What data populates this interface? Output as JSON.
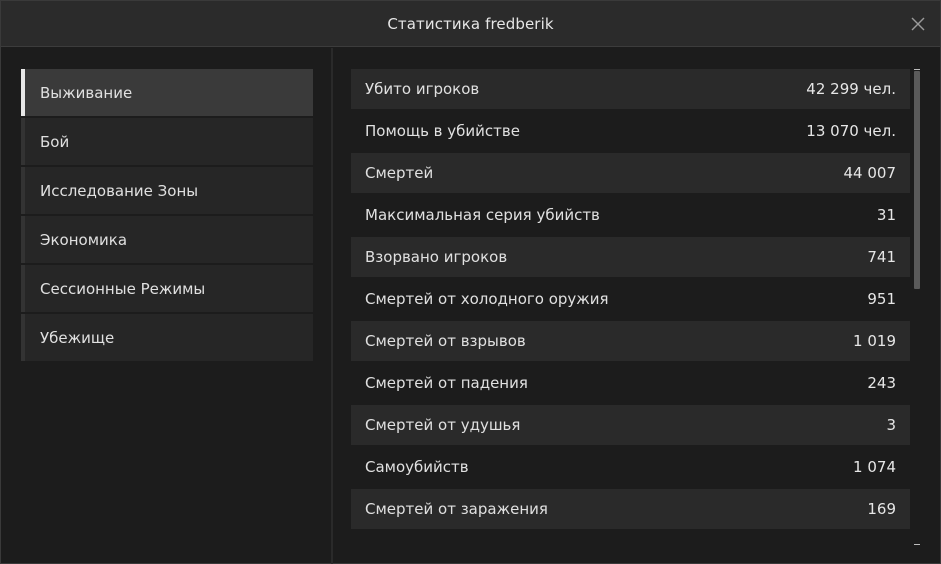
{
  "window": {
    "title": "Статистика fredberik"
  },
  "sidebar": {
    "items": [
      {
        "label": "Выживание",
        "active": true
      },
      {
        "label": "Бой",
        "active": false
      },
      {
        "label": "Исследование Зоны",
        "active": false
      },
      {
        "label": "Экономика",
        "active": false
      },
      {
        "label": "Сессионные Режимы",
        "active": false
      },
      {
        "label": "Убежище",
        "active": false
      }
    ]
  },
  "stats": [
    {
      "label": "Убито игроков",
      "value": "42 299 чел."
    },
    {
      "label": "Помощь в убийстве",
      "value": "13 070 чел."
    },
    {
      "label": "Смертей",
      "value": "44 007"
    },
    {
      "label": "Максимальная серия убийств",
      "value": "31"
    },
    {
      "label": "Взорвано игроков",
      "value": "741"
    },
    {
      "label": "Смертей от холодного оружия",
      "value": "951"
    },
    {
      "label": "Смертей от взрывов",
      "value": "1 019"
    },
    {
      "label": "Смертей от падения",
      "value": "243"
    },
    {
      "label": "Смертей от удушья",
      "value": "3"
    },
    {
      "label": "Самоубийств",
      "value": "1 074"
    },
    {
      "label": "Смертей от заражения",
      "value": "169"
    }
  ],
  "icons": {
    "close": "close-icon"
  },
  "colors": {
    "background": "#1c1c1c",
    "titlebar": "#2b2b2b",
    "active_indicator": "#e8e8e8",
    "row_alt": "#2a2a2a"
  }
}
